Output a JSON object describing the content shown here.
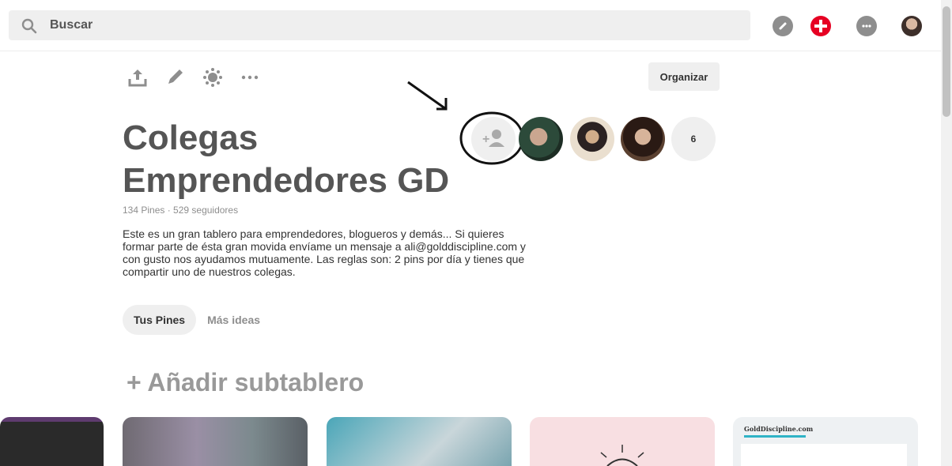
{
  "search": {
    "label": "Buscar"
  },
  "toolbar": {
    "organize_label": "Organizar"
  },
  "board": {
    "title": "Colegas Emprendedores GD",
    "stats": "134 Pines · 529 seguidores",
    "description": "Este es un gran tablero para emprendedores, blogueros y demás... Si quieres formar parte de ésta gran movida envíame un mensaje a ali@golddiscipline.com y con gusto nos ayudamos mutuamente. Las reglas son: 2 pins por día y tienes que compartir uno de nuestros colegas.",
    "collaborator_count": "6"
  },
  "tabs": {
    "active": "Tus Pines",
    "inactive": "Más ideas"
  },
  "add_subboard": "+ Añadir subtablero",
  "pins": {
    "pin5_tag": "GoldDiscipline.com"
  },
  "colors": {
    "brand_red": "#e60023",
    "surface_gray": "#efefef"
  }
}
